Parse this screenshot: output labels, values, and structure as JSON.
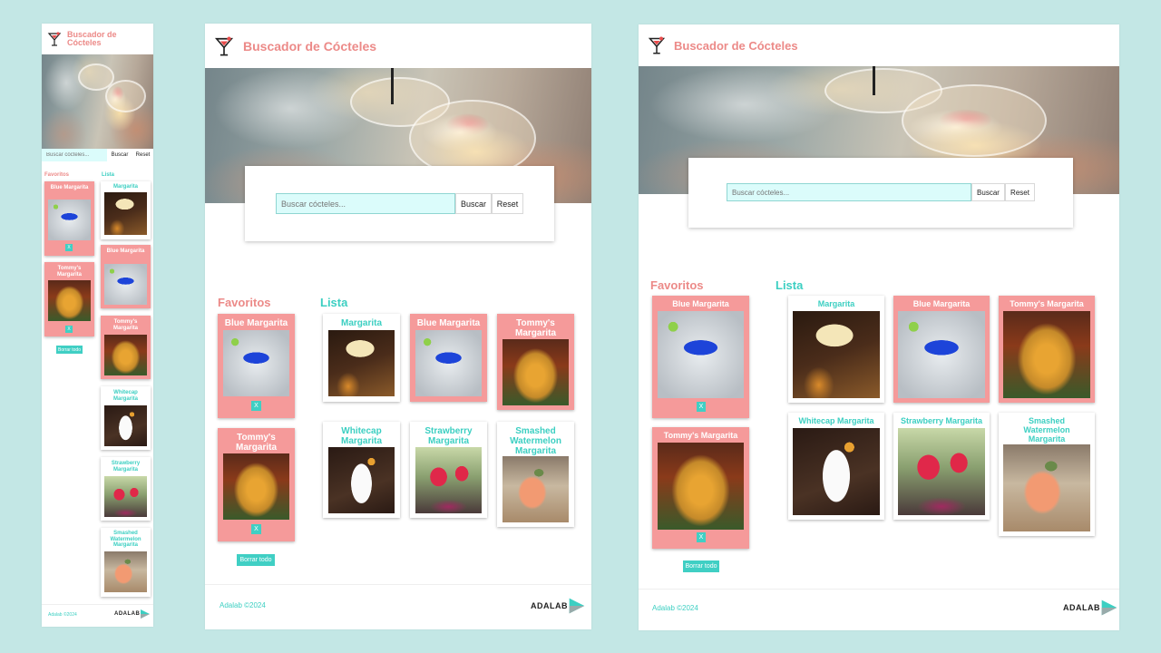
{
  "app": {
    "title": "Buscador de Cócteles",
    "logo_icon": "cocktail-glass-icon"
  },
  "search": {
    "placeholder": "Buscar cócteles...",
    "search_label": "Buscar",
    "reset_label": "Reset"
  },
  "favorites": {
    "title": "Favoritos",
    "items": [
      {
        "name": "Blue Margarita",
        "remove_label": "X"
      },
      {
        "name": "Tommy's Margarita",
        "remove_label": "X"
      }
    ],
    "clear_label": "Borrar todo"
  },
  "list": {
    "title": "Lista",
    "items": [
      {
        "name": "Margarita",
        "favorite": false
      },
      {
        "name": "Blue Margarita",
        "favorite": true
      },
      {
        "name": "Tommy's Margarita",
        "favorite": true
      },
      {
        "name": "Whitecap Margarita",
        "favorite": false
      },
      {
        "name": "Strawberry Margarita",
        "favorite": false
      },
      {
        "name": "Smashed Watermelon Margarita",
        "favorite": false
      }
    ]
  },
  "footer": {
    "copyright": "Adalab ©2024",
    "brand": "ADALAB"
  },
  "colors": {
    "background": "#c3e7e5",
    "accent_pink": "#ec8a88",
    "accent_teal": "#3ccfc2",
    "favorite_card": "#f59a9a"
  }
}
